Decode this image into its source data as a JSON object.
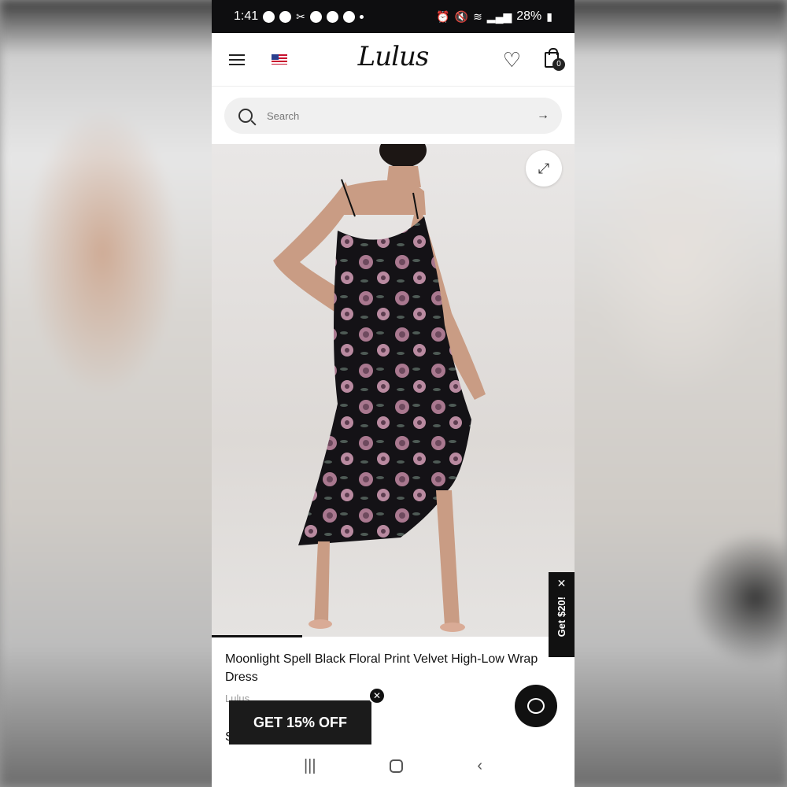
{
  "status_bar": {
    "time": "1:41",
    "battery": "28%"
  },
  "header": {
    "logo": "Lulus",
    "cart_count": "0"
  },
  "search": {
    "placeholder": "Search"
  },
  "product": {
    "title": "Moonlight Spell Black Floral Print Velvet High-Low Wrap Dress",
    "brand": "Lulus",
    "image_slide_progress": 0.25
  },
  "side_promo": {
    "label": "Get $20!"
  },
  "promo_banner": {
    "label": "GET 15% OFF"
  },
  "partial_text": "S",
  "nav": {
    "recents": "|||",
    "back": "‹"
  },
  "colors": {
    "status_bar": "#0e0e10",
    "promo_dark": "#1b1b1b",
    "dress_black": "#141216",
    "flower_pink": "#a9788f"
  }
}
